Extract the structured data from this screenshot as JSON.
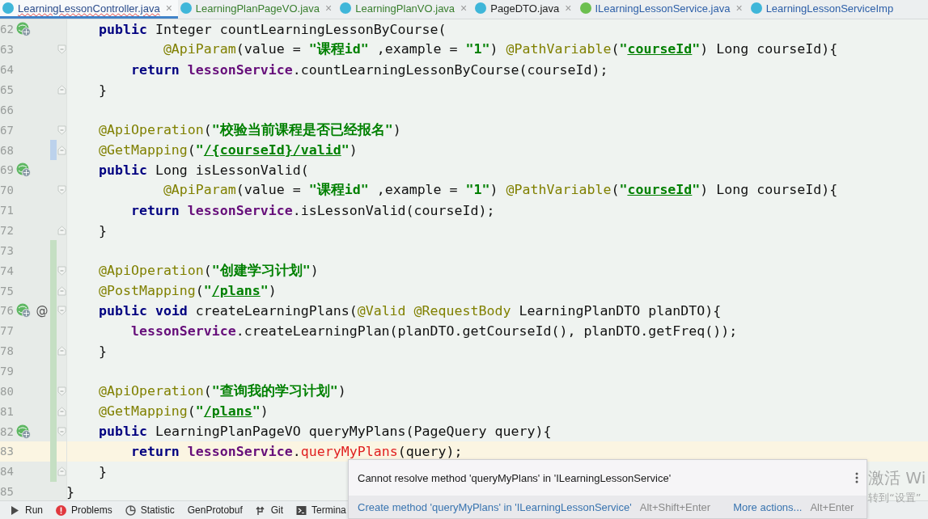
{
  "tabs": [
    {
      "label": "LearningLessonController.java",
      "close": "×",
      "kind": "class",
      "color": "#2b4c8c",
      "error": true,
      "selected": true
    },
    {
      "label": "LearningPlanPageVO.java",
      "close": "×",
      "kind": "class",
      "color": "#3a7f2f",
      "error": false,
      "selected": false
    },
    {
      "label": "LearningPlanVO.java",
      "close": "×",
      "kind": "class",
      "color": "#3a7f2f",
      "error": false,
      "selected": false
    },
    {
      "label": "PageDTO.java",
      "close": "×",
      "kind": "class",
      "color": "#1e1e1e",
      "error": false,
      "selected": false
    },
    {
      "label": "ILearningLessonService.java",
      "close": "×",
      "kind": "interface",
      "color": "#2d5fa8",
      "error": false,
      "selected": false
    },
    {
      "label": "LearningLessonServiceImp",
      "kind": "class",
      "color": "#2d5fa8",
      "error": false,
      "selected": false
    }
  ],
  "lines": [
    {
      "number": "62",
      "endpoint": true,
      "added": false,
      "modified": false,
      "fold_start": false,
      "fold_end": false,
      "current": false,
      "tokens": [
        {
          "kind": "keyword",
          "text": "    public"
        },
        {
          "kind": "plain",
          "text": " Integer countLearningLessonByCourse("
        }
      ]
    },
    {
      "number": "63",
      "endpoint": false,
      "added": false,
      "modified": false,
      "fold_start": true,
      "fold_end": false,
      "current": false,
      "tokens": [
        {
          "kind": "annotation",
          "text": "            @ApiParam"
        },
        {
          "kind": "plain",
          "text": "(value = "
        },
        {
          "kind": "string",
          "text": "\"课程id\""
        },
        {
          "kind": "plain",
          "text": " ,example = "
        },
        {
          "kind": "string",
          "text": "\"1\""
        },
        {
          "kind": "plain",
          "text": ") "
        },
        {
          "kind": "annotation",
          "text": "@PathVariable"
        },
        {
          "kind": "plain",
          "text": "("
        },
        {
          "kind": "string",
          "text": "\""
        },
        {
          "kind": "url",
          "text": "courseId"
        },
        {
          "kind": "string",
          "text": "\""
        },
        {
          "kind": "plain",
          "text": ") Long courseId){"
        }
      ]
    },
    {
      "number": "64",
      "endpoint": false,
      "added": false,
      "modified": false,
      "fold_start": false,
      "fold_end": false,
      "current": false,
      "tokens": [
        {
          "kind": "keyword",
          "text": "        return"
        },
        {
          "kind": "field",
          "text": " lessonService"
        },
        {
          "kind": "plain",
          "text": ".countLearningLessonByCourse(courseId);"
        }
      ]
    },
    {
      "number": "65",
      "endpoint": false,
      "added": false,
      "modified": false,
      "fold_start": false,
      "fold_end": true,
      "current": false,
      "tokens": [
        {
          "kind": "plain",
          "text": "    }"
        }
      ]
    },
    {
      "number": "66",
      "endpoint": false,
      "added": false,
      "modified": false,
      "fold_start": false,
      "fold_end": false,
      "current": false
    },
    {
      "number": "67",
      "endpoint": false,
      "added": false,
      "modified": false,
      "fold_start": true,
      "fold_end": false,
      "current": false,
      "tokens": [
        {
          "kind": "annotation",
          "text": "    @ApiOperation"
        },
        {
          "kind": "plain",
          "text": "("
        },
        {
          "kind": "string",
          "text": "\"校验当前课程是否已经报名\""
        },
        {
          "kind": "plain",
          "text": ")"
        }
      ]
    },
    {
      "number": "68",
      "endpoint": false,
      "added": false,
      "modified": true,
      "fold_start": false,
      "fold_end": true,
      "current": false,
      "tokens": [
        {
          "kind": "annotation",
          "text": "    @GetMapping"
        },
        {
          "kind": "plain",
          "text": "("
        },
        {
          "kind": "string",
          "text": "\""
        },
        {
          "kind": "url",
          "text": "/{courseId}/valid"
        },
        {
          "kind": "string",
          "text": "\""
        },
        {
          "kind": "plain",
          "text": ")"
        }
      ]
    },
    {
      "number": "69",
      "endpoint": true,
      "added": false,
      "modified": false,
      "fold_start": false,
      "fold_end": false,
      "current": false,
      "tokens": [
        {
          "kind": "keyword",
          "text": "    public"
        },
        {
          "kind": "plain",
          "text": " Long isLessonValid("
        }
      ]
    },
    {
      "number": "70",
      "endpoint": false,
      "added": false,
      "modified": false,
      "fold_start": true,
      "fold_end": false,
      "current": false,
      "tokens": [
        {
          "kind": "annotation",
          "text": "            @ApiParam"
        },
        {
          "kind": "plain",
          "text": "(value = "
        },
        {
          "kind": "string",
          "text": "\"课程id\""
        },
        {
          "kind": "plain",
          "text": " ,example = "
        },
        {
          "kind": "string",
          "text": "\"1\""
        },
        {
          "kind": "plain",
          "text": ") "
        },
        {
          "kind": "annotation",
          "text": "@PathVariable"
        },
        {
          "kind": "plain",
          "text": "("
        },
        {
          "kind": "string",
          "text": "\""
        },
        {
          "kind": "url",
          "text": "courseId"
        },
        {
          "kind": "string",
          "text": "\""
        },
        {
          "kind": "plain",
          "text": ") Long courseId){"
        }
      ]
    },
    {
      "number": "71",
      "endpoint": false,
      "added": false,
      "modified": false,
      "fold_start": false,
      "fold_end": false,
      "current": false,
      "tokens": [
        {
          "kind": "keyword",
          "text": "        return"
        },
        {
          "kind": "field",
          "text": " lessonService"
        },
        {
          "kind": "plain",
          "text": ".isLessonValid(courseId);"
        }
      ]
    },
    {
      "number": "72",
      "endpoint": false,
      "added": false,
      "modified": false,
      "fold_start": false,
      "fold_end": true,
      "current": false,
      "tokens": [
        {
          "kind": "plain",
          "text": "    }"
        }
      ]
    },
    {
      "number": "73",
      "endpoint": false,
      "added": true,
      "modified": false,
      "fold_start": false,
      "fold_end": false,
      "current": false
    },
    {
      "number": "74",
      "endpoint": false,
      "added": true,
      "modified": false,
      "fold_start": true,
      "fold_end": false,
      "current": false,
      "tokens": [
        {
          "kind": "annotation",
          "text": "    @ApiOperation"
        },
        {
          "kind": "plain",
          "text": "("
        },
        {
          "kind": "string",
          "text": "\"创建学习计划\""
        },
        {
          "kind": "plain",
          "text": ")"
        }
      ]
    },
    {
      "number": "75",
      "endpoint": false,
      "added": true,
      "modified": false,
      "fold_start": false,
      "fold_end": true,
      "current": false,
      "tokens": [
        {
          "kind": "annotation",
          "text": "    @PostMapping"
        },
        {
          "kind": "plain",
          "text": "("
        },
        {
          "kind": "string",
          "text": "\""
        },
        {
          "kind": "url",
          "text": "/plans"
        },
        {
          "kind": "string",
          "text": "\""
        },
        {
          "kind": "plain",
          "text": ")"
        }
      ]
    },
    {
      "number": "76",
      "endpoint": true,
      "gutter_mark": "@",
      "added": true,
      "modified": false,
      "fold_start": true,
      "fold_end": false,
      "current": false,
      "tokens": [
        {
          "kind": "keyword",
          "text": "    public"
        },
        {
          "kind": "keyword",
          "text": " void"
        },
        {
          "kind": "plain",
          "text": " createLearningPlans("
        },
        {
          "kind": "annotation",
          "text": "@Valid"
        },
        {
          "kind": "annotation",
          "text": " @RequestBody"
        },
        {
          "kind": "plain",
          "text": " LearningPlanDTO planDTO){"
        }
      ]
    },
    {
      "number": "77",
      "endpoint": false,
      "added": true,
      "modified": false,
      "fold_start": false,
      "fold_end": false,
      "current": false,
      "tokens": [
        {
          "kind": "field",
          "text": "        lessonService"
        },
        {
          "kind": "plain",
          "text": ".createLearningPlan(planDTO.getCourseId(), planDTO.getFreq());"
        }
      ]
    },
    {
      "number": "78",
      "endpoint": false,
      "added": true,
      "modified": false,
      "fold_start": false,
      "fold_end": true,
      "current": false,
      "tokens": [
        {
          "kind": "plain",
          "text": "    }"
        }
      ]
    },
    {
      "number": "79",
      "endpoint": false,
      "added": true,
      "modified": false,
      "fold_start": false,
      "fold_end": false,
      "current": false
    },
    {
      "number": "80",
      "endpoint": false,
      "added": true,
      "modified": false,
      "fold_start": true,
      "fold_end": false,
      "current": false,
      "tokens": [
        {
          "kind": "annotation",
          "text": "    @ApiOperation"
        },
        {
          "kind": "plain",
          "text": "("
        },
        {
          "kind": "string",
          "text": "\"查询我的学习计划\""
        },
        {
          "kind": "plain",
          "text": ")"
        }
      ]
    },
    {
      "number": "81",
      "endpoint": false,
      "added": true,
      "modified": false,
      "fold_start": false,
      "fold_end": true,
      "current": false,
      "tokens": [
        {
          "kind": "annotation",
          "text": "    @GetMapping"
        },
        {
          "kind": "plain",
          "text": "("
        },
        {
          "kind": "string",
          "text": "\""
        },
        {
          "kind": "url",
          "text": "/plans"
        },
        {
          "kind": "string",
          "text": "\""
        },
        {
          "kind": "plain",
          "text": ")"
        }
      ]
    },
    {
      "number": "82",
      "endpoint": true,
      "added": true,
      "modified": false,
      "fold_start": true,
      "fold_end": false,
      "current": false,
      "tokens": [
        {
          "kind": "keyword",
          "text": "    public"
        },
        {
          "kind": "plain",
          "text": " LearningPlanPageVO queryMyPlans(PageQuery query){"
        }
      ]
    },
    {
      "number": "83",
      "endpoint": false,
      "added": true,
      "modified": false,
      "fold_start": false,
      "fold_end": false,
      "current": true,
      "tokens": [
        {
          "kind": "keyword",
          "text": "        return"
        },
        {
          "kind": "field",
          "text": " lessonService"
        },
        {
          "kind": "plain",
          "text": "."
        },
        {
          "kind": "error",
          "text": "queryMyPlans"
        },
        {
          "kind": "plain",
          "text": "(query);"
        }
      ]
    },
    {
      "number": "84",
      "endpoint": false,
      "added": true,
      "modified": false,
      "fold_start": false,
      "fold_end": true,
      "current": false,
      "tokens": [
        {
          "kind": "plain",
          "text": "    }"
        }
      ]
    },
    {
      "number": "85",
      "endpoint": false,
      "added": false,
      "modified": false,
      "fold_start": false,
      "fold_end": false,
      "current": false,
      "tokens": [
        {
          "kind": "plain",
          "text": "}"
        }
      ]
    }
  ],
  "tool_windows": [
    {
      "label": "Run",
      "kind": "run"
    },
    {
      "label": "Problems",
      "kind": "problems"
    },
    {
      "label": "Statistic",
      "kind": "statistic"
    },
    {
      "label": "GenProtobuf",
      "kind": "text"
    },
    {
      "label": "Git",
      "kind": "git"
    },
    {
      "label": "Termina",
      "kind": "terminal"
    }
  ],
  "popup": {
    "message": "Cannot resolve method 'queryMyPlans' in 'ILearningLessonService'",
    "action": "Create method 'queryMyPlans' in 'ILearningLessonService'",
    "action_shortcut": "Alt+Shift+Enter",
    "more": "More actions...",
    "more_shortcut": "Alt+Enter"
  },
  "windows_activation": {
    "title": "激活 Wi",
    "hint": "转到“设置”"
  }
}
